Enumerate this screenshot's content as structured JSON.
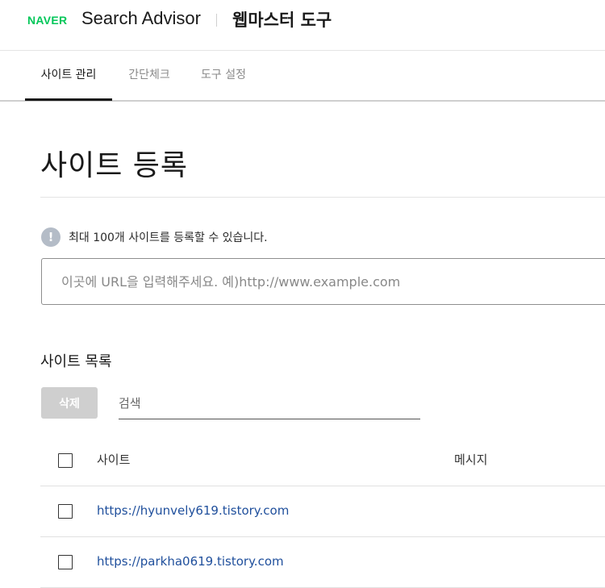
{
  "header": {
    "logo": "NAVER",
    "product": "Search Advisor",
    "section": "웹마스터 도구"
  },
  "tabs": [
    {
      "label": "사이트 관리",
      "active": true
    },
    {
      "label": "간단체크",
      "active": false
    },
    {
      "label": "도구 설정",
      "active": false
    }
  ],
  "page": {
    "title": "사이트 등록",
    "notice_icon": "!",
    "notice": "최대 100개 사이트를 등록할 수 있습니다.",
    "url_placeholder": "이곳에 URL을 입력해주세요. 예)http://www.example.com"
  },
  "site_list": {
    "title": "사이트 목록",
    "delete_label": "삭제",
    "search_placeholder": "검색",
    "columns": {
      "site": "사이트",
      "message": "메시지"
    },
    "rows": [
      {
        "url": "https://hyunvely619.tistory.com",
        "message": ""
      },
      {
        "url": "https://parkha0619.tistory.com",
        "message": ""
      }
    ]
  },
  "colors": {
    "naver_green": "#03c75a",
    "link_blue": "#1f4f9c",
    "disabled_button": "#cfcfcf"
  },
  "icons": {
    "notice": "info-exclamation-icon"
  }
}
